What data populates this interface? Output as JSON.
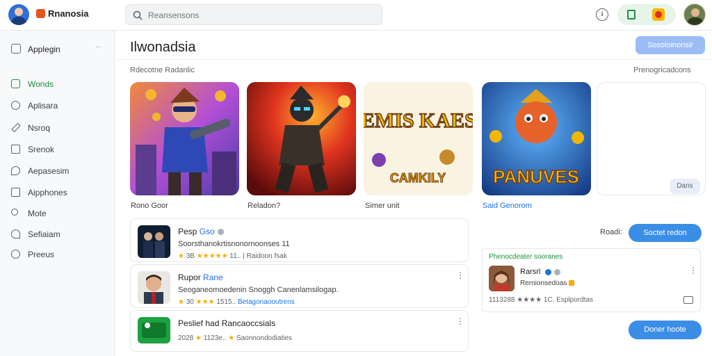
{
  "header": {
    "app_name": "Rnanosia",
    "search_placeholder": "Reansensons",
    "info_icon": "info-icon",
    "pill_icons": [
      "grid-icon",
      "game-icon"
    ]
  },
  "sidebar": {
    "header_label": "Applegin",
    "header_more": "··",
    "items": [
      {
        "label": "Wonds",
        "icon": "wand-icon",
        "active": true
      },
      {
        "label": "Aplisara",
        "icon": "globe-icon"
      },
      {
        "label": "Nsroq",
        "icon": "pencil-icon"
      },
      {
        "label": "Srenok",
        "icon": "square-icon"
      },
      {
        "label": "Aepasesim",
        "icon": "chat-icon"
      },
      {
        "label": "Aipphones",
        "icon": "apps-icon"
      },
      {
        "label": "Mote",
        "icon": "people-icon"
      },
      {
        "label": "Sefiaiam",
        "icon": "message-icon"
      },
      {
        "label": "Preeus",
        "icon": "circle-icon"
      }
    ]
  },
  "main": {
    "title": "Ilwonadsia",
    "top_button": "Sosoloinonsir",
    "section_left": "Rdecotne Radanlic",
    "section_right": "Prenogricadcons",
    "cards": [
      {
        "label": "Rono Goor"
      },
      {
        "label": "Reladon?"
      },
      {
        "label": "Simer unit",
        "art_title": "DEMIS KAES!!",
        "art_sub": "CAMKILY"
      },
      {
        "label": "Said Genorom",
        "art_title": "PANUVES"
      },
      {
        "label": "",
        "button": "Dans"
      }
    ],
    "list": [
      {
        "name": "Pesp",
        "tag": "Gso",
        "desc": "Soorsthanokrtisnonornoonses 11",
        "meta": [
          "★",
          "3B",
          "★★★★★",
          "11..",
          "Raidoon fsak"
        ]
      },
      {
        "name": "Rupor",
        "tag": "Rane",
        "desc": "Seoganeomoedenin Snoggh Canenlamsilogap.",
        "meta": [
          "★",
          "30",
          "★★★",
          "1515..",
          "Betagonaooutrens"
        ]
      },
      {
        "name": "Peslief had Rancaoccsials",
        "tag": "",
        "desc": "",
        "meta": [
          "",
          "2028",
          "★",
          "1123е..",
          "Saonnondodiaties"
        ]
      }
    ],
    "right_label": "Roadi:",
    "right_button": "Soctet redon",
    "feature": {
      "header": "Phenocdeater sooranes",
      "name": "Rarsrl",
      "sub": "Rernionsedoas",
      "meta": "1113288 ★★★★ 1C. Esplpordtas"
    },
    "bottom_button": "Doner hoote"
  }
}
